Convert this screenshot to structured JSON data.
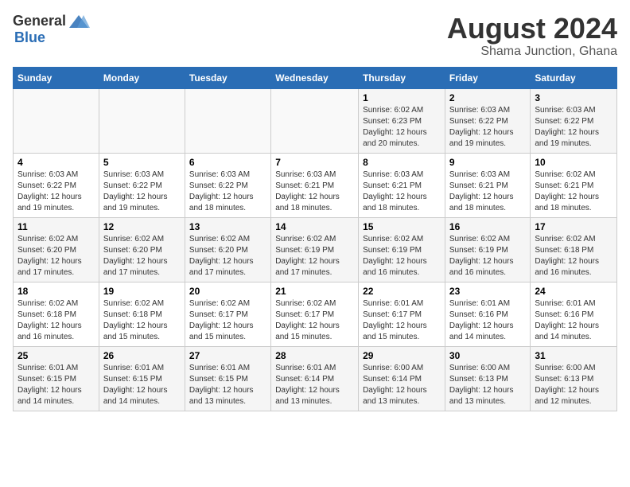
{
  "logo": {
    "general": "General",
    "blue": "Blue"
  },
  "title": "August 2024",
  "subtitle": "Shama Junction, Ghana",
  "days_of_week": [
    "Sunday",
    "Monday",
    "Tuesday",
    "Wednesday",
    "Thursday",
    "Friday",
    "Saturday"
  ],
  "weeks": [
    [
      {
        "num": "",
        "info": ""
      },
      {
        "num": "",
        "info": ""
      },
      {
        "num": "",
        "info": ""
      },
      {
        "num": "",
        "info": ""
      },
      {
        "num": "1",
        "info": "Sunrise: 6:02 AM\nSunset: 6:23 PM\nDaylight: 12 hours and 20 minutes."
      },
      {
        "num": "2",
        "info": "Sunrise: 6:03 AM\nSunset: 6:22 PM\nDaylight: 12 hours and 19 minutes."
      },
      {
        "num": "3",
        "info": "Sunrise: 6:03 AM\nSunset: 6:22 PM\nDaylight: 12 hours and 19 minutes."
      }
    ],
    [
      {
        "num": "4",
        "info": "Sunrise: 6:03 AM\nSunset: 6:22 PM\nDaylight: 12 hours and 19 minutes."
      },
      {
        "num": "5",
        "info": "Sunrise: 6:03 AM\nSunset: 6:22 PM\nDaylight: 12 hours and 19 minutes."
      },
      {
        "num": "6",
        "info": "Sunrise: 6:03 AM\nSunset: 6:22 PM\nDaylight: 12 hours and 18 minutes."
      },
      {
        "num": "7",
        "info": "Sunrise: 6:03 AM\nSunset: 6:21 PM\nDaylight: 12 hours and 18 minutes."
      },
      {
        "num": "8",
        "info": "Sunrise: 6:03 AM\nSunset: 6:21 PM\nDaylight: 12 hours and 18 minutes."
      },
      {
        "num": "9",
        "info": "Sunrise: 6:03 AM\nSunset: 6:21 PM\nDaylight: 12 hours and 18 minutes."
      },
      {
        "num": "10",
        "info": "Sunrise: 6:02 AM\nSunset: 6:21 PM\nDaylight: 12 hours and 18 minutes."
      }
    ],
    [
      {
        "num": "11",
        "info": "Sunrise: 6:02 AM\nSunset: 6:20 PM\nDaylight: 12 hours and 17 minutes."
      },
      {
        "num": "12",
        "info": "Sunrise: 6:02 AM\nSunset: 6:20 PM\nDaylight: 12 hours and 17 minutes."
      },
      {
        "num": "13",
        "info": "Sunrise: 6:02 AM\nSunset: 6:20 PM\nDaylight: 12 hours and 17 minutes."
      },
      {
        "num": "14",
        "info": "Sunrise: 6:02 AM\nSunset: 6:19 PM\nDaylight: 12 hours and 17 minutes."
      },
      {
        "num": "15",
        "info": "Sunrise: 6:02 AM\nSunset: 6:19 PM\nDaylight: 12 hours and 16 minutes."
      },
      {
        "num": "16",
        "info": "Sunrise: 6:02 AM\nSunset: 6:19 PM\nDaylight: 12 hours and 16 minutes."
      },
      {
        "num": "17",
        "info": "Sunrise: 6:02 AM\nSunset: 6:18 PM\nDaylight: 12 hours and 16 minutes."
      }
    ],
    [
      {
        "num": "18",
        "info": "Sunrise: 6:02 AM\nSunset: 6:18 PM\nDaylight: 12 hours and 16 minutes."
      },
      {
        "num": "19",
        "info": "Sunrise: 6:02 AM\nSunset: 6:18 PM\nDaylight: 12 hours and 15 minutes."
      },
      {
        "num": "20",
        "info": "Sunrise: 6:02 AM\nSunset: 6:17 PM\nDaylight: 12 hours and 15 minutes."
      },
      {
        "num": "21",
        "info": "Sunrise: 6:02 AM\nSunset: 6:17 PM\nDaylight: 12 hours and 15 minutes."
      },
      {
        "num": "22",
        "info": "Sunrise: 6:01 AM\nSunset: 6:17 PM\nDaylight: 12 hours and 15 minutes."
      },
      {
        "num": "23",
        "info": "Sunrise: 6:01 AM\nSunset: 6:16 PM\nDaylight: 12 hours and 14 minutes."
      },
      {
        "num": "24",
        "info": "Sunrise: 6:01 AM\nSunset: 6:16 PM\nDaylight: 12 hours and 14 minutes."
      }
    ],
    [
      {
        "num": "25",
        "info": "Sunrise: 6:01 AM\nSunset: 6:15 PM\nDaylight: 12 hours and 14 minutes."
      },
      {
        "num": "26",
        "info": "Sunrise: 6:01 AM\nSunset: 6:15 PM\nDaylight: 12 hours and 14 minutes."
      },
      {
        "num": "27",
        "info": "Sunrise: 6:01 AM\nSunset: 6:15 PM\nDaylight: 12 hours and 13 minutes."
      },
      {
        "num": "28",
        "info": "Sunrise: 6:01 AM\nSunset: 6:14 PM\nDaylight: 12 hours and 13 minutes."
      },
      {
        "num": "29",
        "info": "Sunrise: 6:00 AM\nSunset: 6:14 PM\nDaylight: 12 hours and 13 minutes."
      },
      {
        "num": "30",
        "info": "Sunrise: 6:00 AM\nSunset: 6:13 PM\nDaylight: 12 hours and 13 minutes."
      },
      {
        "num": "31",
        "info": "Sunrise: 6:00 AM\nSunset: 6:13 PM\nDaylight: 12 hours and 12 minutes."
      }
    ]
  ]
}
